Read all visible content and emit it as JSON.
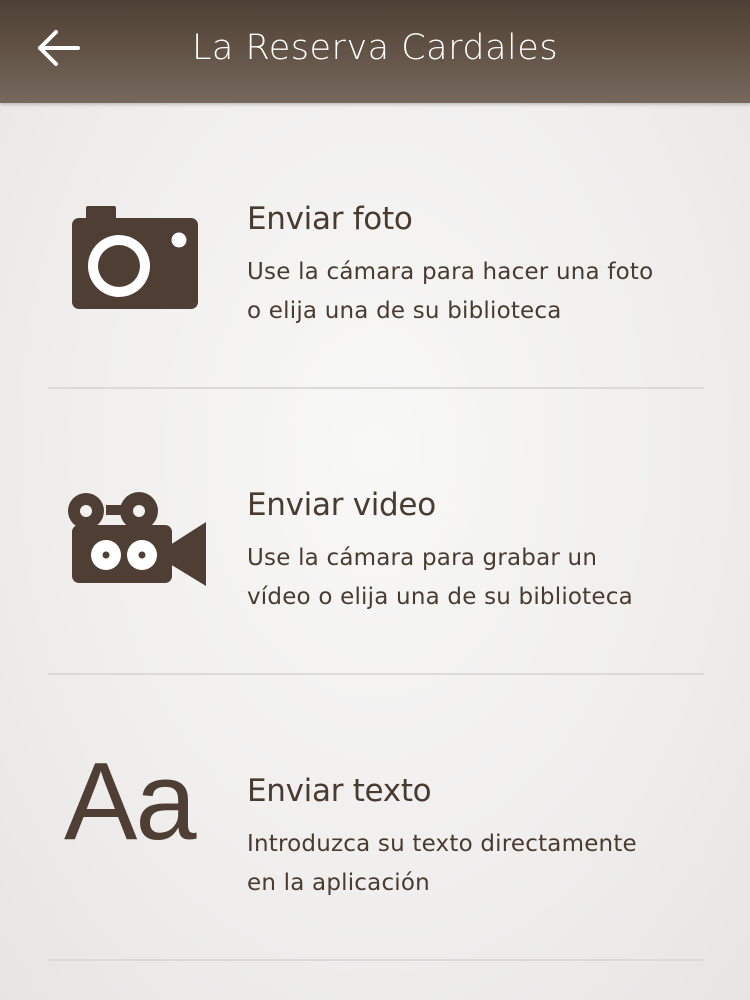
{
  "header": {
    "title": "La Reserva Cardales",
    "back_icon": "arrow-left-icon"
  },
  "options": [
    {
      "icon": "camera-icon",
      "title": "Enviar foto",
      "description_line1": "Use la cámara para hacer una foto",
      "description_line2": "o elija una de su biblioteca"
    },
    {
      "icon": "video-camera-icon",
      "title": "Enviar video",
      "description_line1": "Use la cámara para grabar un",
      "description_line2": "vídeo o elija una de su biblioteca"
    },
    {
      "icon": "text-icon",
      "icon_text": "Aa",
      "title": "Enviar texto",
      "description_line1": "Introduzca su texto directamente",
      "description_line2": "en la aplicación"
    }
  ],
  "colors": {
    "header_bg": "#5e4f42",
    "accent_brown": "#4a3b2f",
    "background": "#f3f2f1",
    "divider": "#dcdad8"
  }
}
